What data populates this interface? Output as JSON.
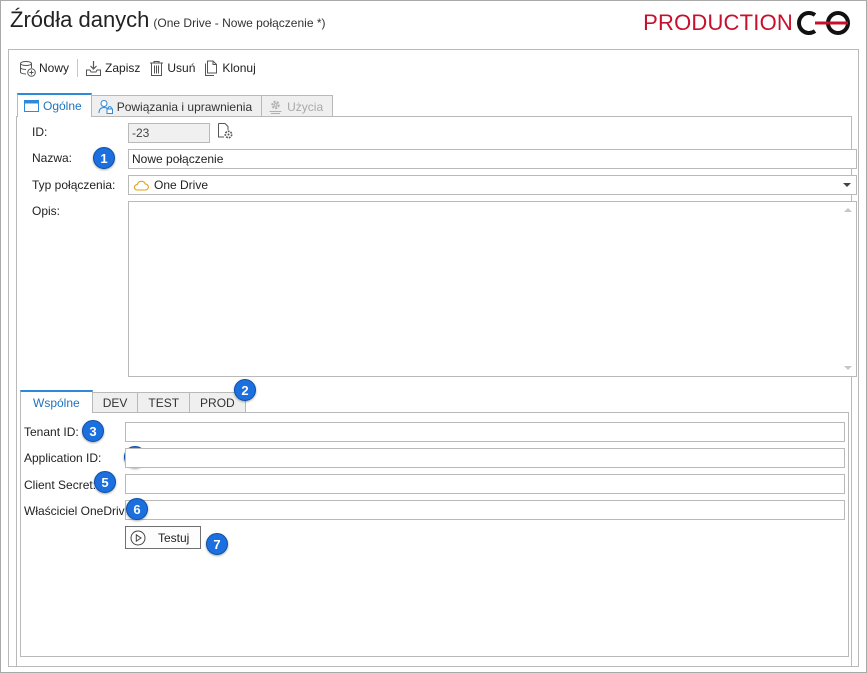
{
  "window": {
    "title": "Źródła danych",
    "subtitle": "(One Drive - Nowe połączenie *)",
    "brand": "PRODUCTION",
    "brand_color": "#c8102e",
    "accent_color": "#1e73be"
  },
  "toolbar": {
    "new_label": "Nowy",
    "save_label": "Zapisz",
    "delete_label": "Usuń",
    "clone_label": "Klonuj"
  },
  "tabs": [
    {
      "label": "Ogólne",
      "icon": "window-icon",
      "active": true
    },
    {
      "label": "Powiązania i uprawnienia",
      "icon": "user-lock-icon",
      "active": false
    },
    {
      "label": "Użycia",
      "icon": "gear-icon",
      "active": false,
      "disabled": true
    }
  ],
  "form": {
    "id_label": "ID:",
    "id_value": "-23",
    "name_label": "Nazwa:",
    "name_value": "Nowe połączenie",
    "type_label": "Typ połączenia:",
    "type_value": "One Drive",
    "desc_label": "Opis:",
    "desc_value": ""
  },
  "env_tabs": [
    {
      "label": "Wspólne",
      "active": true
    },
    {
      "label": "DEV",
      "active": false
    },
    {
      "label": "TEST",
      "active": false
    },
    {
      "label": "PROD",
      "active": false
    }
  ],
  "connection": {
    "tenant_label": "Tenant ID:",
    "tenant_value": "",
    "app_label": "Application ID:",
    "app_value": "",
    "secret_label": "Client Secret:",
    "secret_value": "",
    "owner_label": "Właściciel OneDrive:",
    "owner_value": "",
    "test_label": "Testuj"
  },
  "badges": [
    "1",
    "2",
    "3",
    "4",
    "5",
    "6",
    "7"
  ],
  "badge_color": "#1b6fde"
}
